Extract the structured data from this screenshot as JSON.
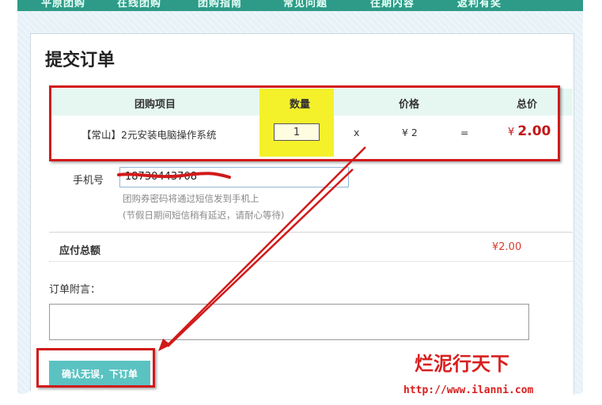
{
  "nav": {
    "items": [
      "平原团购",
      "在线团购",
      "团购指南",
      "常见问题",
      "往期内容",
      "返利有奖"
    ]
  },
  "page": {
    "title": "提交订单"
  },
  "table": {
    "headers": {
      "item": "团购项目",
      "quantity": "数量",
      "price": "价格",
      "total": "总价"
    },
    "row": {
      "item": "【常山】2元安装电脑操作系统",
      "quantity": "1",
      "multiply": "x",
      "price": "¥ 2",
      "equals": "=",
      "total_currency": "¥",
      "total_amount": "2.00"
    }
  },
  "phone": {
    "label": "手机号",
    "value": "18730443708",
    "hint1": "团购券密码将通过短信发到手机上",
    "hint2": "(节假日期间短信稍有延迟，请耐心等待)"
  },
  "payment": {
    "label": "应付总额",
    "value": "¥2.00"
  },
  "note": {
    "label": "订单附言：",
    "value": ""
  },
  "submit": {
    "label": "确认无误，下订单"
  },
  "watermark": {
    "text": "烂泥行天下",
    "url": "http://www.ilanni.com"
  },
  "colors": {
    "nav_bg": "#2d9b87",
    "highlight_yellow": "#f4f12a",
    "annotation_red": "#d11a1a",
    "price_red": "#c01818",
    "button_teal": "#5bc2c2"
  }
}
